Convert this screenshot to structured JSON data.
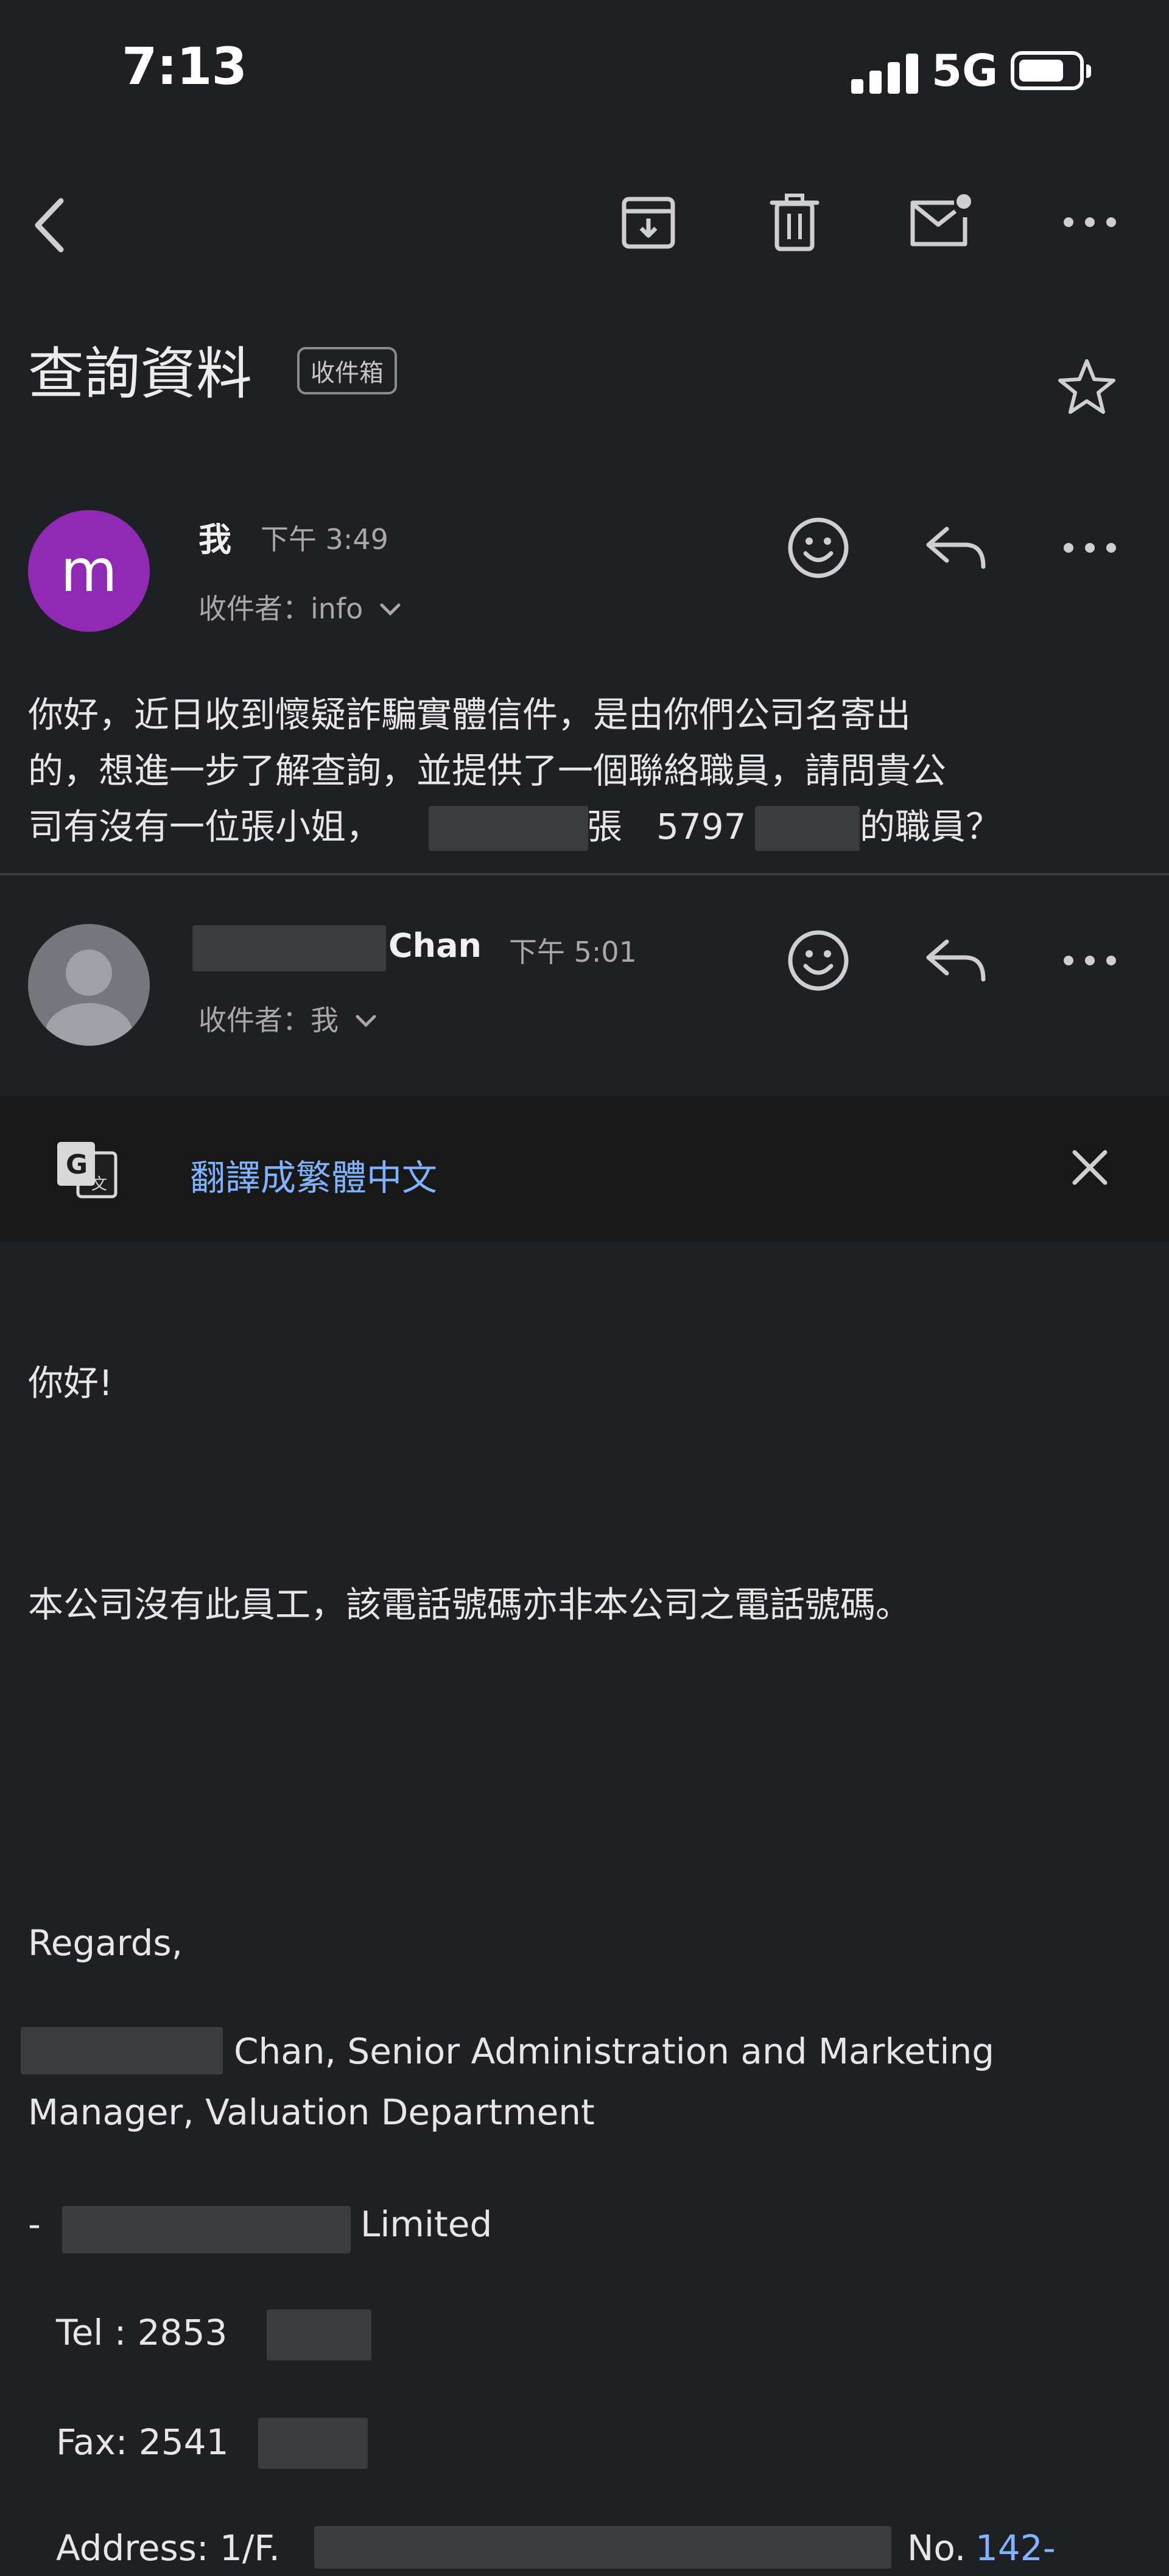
{
  "status_bar": {
    "time": "7:13",
    "network": "5G"
  },
  "subject": {
    "title": "查詢資料",
    "folder": "收件箱"
  },
  "message1": {
    "avatar_letter": "m",
    "sender": "我",
    "time": "下午 3:49",
    "to": "收件者：info",
    "body_line1": "你好，近日收到懷疑詐騙實體信件，是由你們公司名寄出",
    "body_line2": "的，想進一步了解查詢，並提供了一個聯絡職員，請問貴公",
    "body_line3_a": "司有沒有一位張小姐，",
    "body_line3_b": "張",
    "body_line3_c": "5797",
    "body_line3_d": "的職員？"
  },
  "message2": {
    "sender": "Chan",
    "time": "下午 5:01",
    "to": "收件者：我",
    "translate_label": "翻譯成繁體中文",
    "greeting": "你好!",
    "statement": "本公司沒有此員工，該電話號碼亦非本公司之電話號碼。",
    "regards": "Regards,",
    "sig_line1": "Chan, Senior Administration and Marketing",
    "sig_line2": "Manager, Valuation Department",
    "company_prefix": "-",
    "company_suffix": "Limited",
    "tel": "Tel : 2853",
    "fax": "Fax: 2541",
    "address_prefix": "Address: 1/F.",
    "address_no": "No.",
    "address_link": "142-"
  }
}
